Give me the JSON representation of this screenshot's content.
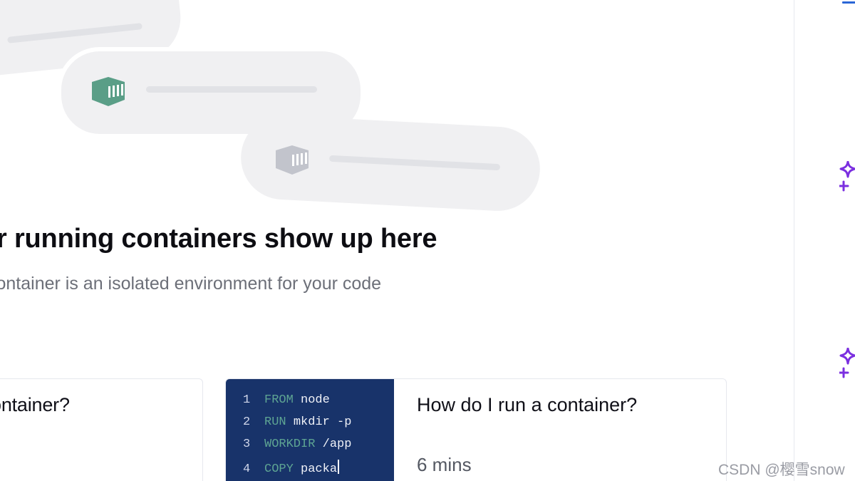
{
  "empty_state": {
    "title": "ur running containers show up here",
    "subtitle": "container is an isolated environment for your code",
    "container_icon_active_color": "#5a9e87",
    "container_icon_inactive_color": "#c2c4cc"
  },
  "cards": [
    {
      "title": "ontainer?"
    },
    {
      "title": "How do I run a container?",
      "duration": "6 mins",
      "code_lines": [
        {
          "num": "1",
          "keyword": "FROM",
          "arg": "node"
        },
        {
          "num": "2",
          "keyword": "RUN",
          "arg": "mkdir -p"
        },
        {
          "num": "3",
          "keyword": "WORKDIR",
          "arg": "/app"
        },
        {
          "num": "4",
          "keyword": "COPY",
          "arg": "packa"
        }
      ]
    }
  ],
  "sidebar": {
    "accent_color": "#7b2fe0",
    "items": [
      {
        "icon": "sparkle-icon"
      },
      {
        "icon": "sparkle-icon"
      }
    ]
  },
  "watermark": "CSDN @樱雪snow"
}
